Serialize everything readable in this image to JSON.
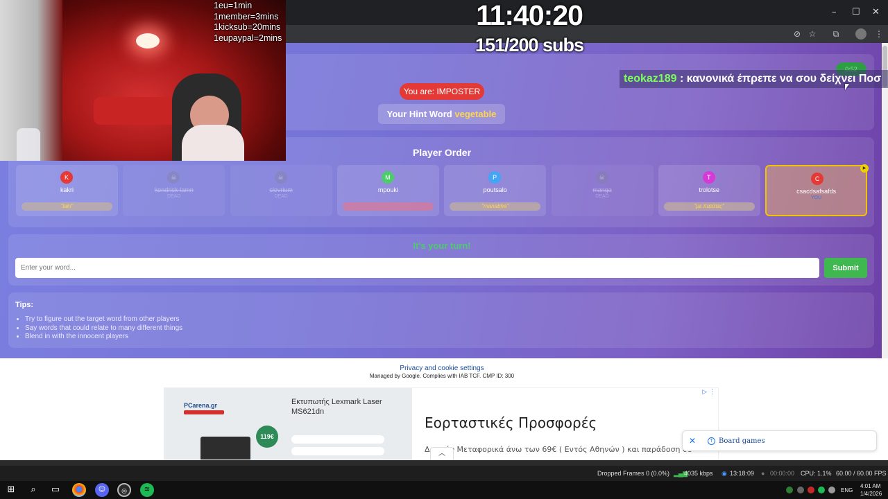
{
  "stream": {
    "rates": [
      "1eu=1min",
      "1member=3mins",
      "1kicksub=20mins",
      "1eupaypal=2mins"
    ],
    "clock": "11:40:20",
    "subs": "151/200 subs"
  },
  "chat": {
    "user": "teokaz189",
    "message": " : κανονικά έπρεπε να σου δείχνει Ποσ"
  },
  "game": {
    "role_badge": "You are: IMPOSTER",
    "hint_label": "Your Hint Word",
    "hint_word": "vegetable",
    "round_timer": "0:52",
    "player_order_title": "Player Order",
    "players": [
      {
        "initial": "K",
        "name": "kakri",
        "status": "",
        "word": "\"laki\"",
        "color": "#e53935",
        "dead": false,
        "me": false,
        "word_style": "normal"
      },
      {
        "initial": "☠",
        "name": "kendrick-lamn",
        "status": "DEAD",
        "word": "",
        "color": "#8a8aa8",
        "dead": true,
        "me": false,
        "word_style": "none"
      },
      {
        "initial": "☠",
        "name": "clevrium",
        "status": "DEAD",
        "word": "",
        "color": "#8a8aa8",
        "dead": true,
        "me": false,
        "word_style": "none"
      },
      {
        "initial": "M",
        "name": "mpouki",
        "status": "",
        "word": "",
        "color": "#4ccc6a",
        "dead": false,
        "me": false,
        "word_style": "red"
      },
      {
        "initial": "P",
        "name": "poutsalo",
        "status": "",
        "word": "\"manabha\"",
        "color": "#42a5f5",
        "dead": false,
        "me": false,
        "word_style": "normal"
      },
      {
        "initial": "☠",
        "name": "manga",
        "status": "DEAD",
        "word": "",
        "color": "#8a8aa8",
        "dead": true,
        "me": false,
        "word_style": "none"
      },
      {
        "initial": "T",
        "name": "trolotse",
        "status": "",
        "word": "\"με πατάτες\"",
        "color": "#d63ad6",
        "dead": false,
        "me": false,
        "word_style": "normal"
      },
      {
        "initial": "C",
        "name": "csacdsafsafds",
        "status": "YOU",
        "word": "",
        "color": "#e53935",
        "dead": false,
        "me": true,
        "word_style": "none"
      }
    ],
    "turn_text": "It's your turn!",
    "input_placeholder": "Enter your word...",
    "submit_label": "Submit",
    "tips_title": "Tips:",
    "tips": [
      "Try to figure out the target word from other players",
      "Say words that could relate to many different things",
      "Blend in with the innocent players"
    ]
  },
  "footer": {
    "privacy_link": "Privacy and cookie settings",
    "managed_text": "Managed by Google. Complies with IAB TCF. CMP ID: 300"
  },
  "ad": {
    "brand": "PCarena.gr",
    "product": "Εκτυπωτής Lexmark Laser MS621dn",
    "price": "119€",
    "headline": "Εορταστικές Προσφορές",
    "description": "Δωρεάν Μεταφορικά άνω των 69€ ( Εντός Αθηνών ) και παράδοση σε"
  },
  "board_chip": {
    "label": "Board games"
  },
  "obs": {
    "dropped_frames": "Dropped Frames 0 (0.0%)",
    "bitrate": "4035 kbps",
    "stream_time": "13:18:09",
    "rec_time": "00:00:00",
    "cpu": "CPU: 1.1%",
    "fps": "60.00 / 60.00 FPS"
  },
  "taskbar": {
    "language": "ENG",
    "time": "4:01 AM",
    "date": "1/4/2026"
  },
  "icons": [
    "windows-icon",
    "search-icon",
    "task-view-icon",
    "chrome-icon",
    "discord-icon",
    "obs-icon",
    "spotify-icon",
    "extensions-icon",
    "bookmark-star-icon",
    "profile-icon"
  ]
}
